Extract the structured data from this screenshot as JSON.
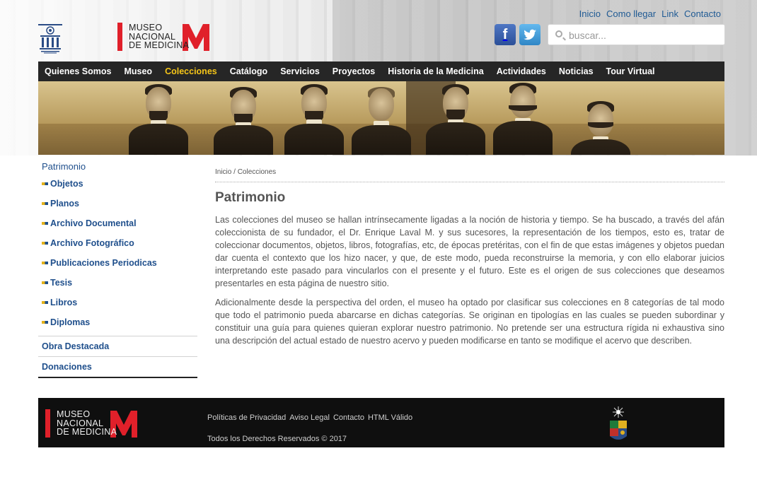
{
  "top_links": [
    "Inicio",
    "Como llegar",
    "Link",
    "Contacto"
  ],
  "logo": {
    "lines": [
      "MUSEO",
      "NACIONAL",
      "DE MEDICINA"
    ],
    "mark": "M"
  },
  "social": [
    "facebook-icon",
    "twitter-icon"
  ],
  "search": {
    "placeholder": "buscar..."
  },
  "nav": [
    {
      "label": "Quienes Somos",
      "active": false
    },
    {
      "label": "Museo",
      "active": false
    },
    {
      "label": "Colecciones",
      "active": true
    },
    {
      "label": "Catálogo",
      "active": false
    },
    {
      "label": "Servicios",
      "active": false
    },
    {
      "label": "Proyectos",
      "active": false
    },
    {
      "label": "Historia de la Medicina",
      "active": false
    },
    {
      "label": "Actividades",
      "active": false
    },
    {
      "label": "Noticias",
      "active": false
    },
    {
      "label": "Tour Virtual",
      "active": false
    }
  ],
  "sidebar": {
    "title": "Patrimonio",
    "items": [
      "Objetos",
      "Planos",
      "Archivo Documental",
      "Archivo Fotográfico",
      "Publicaciones Periodicas",
      "Tesis",
      "Libros",
      "Diplomas"
    ],
    "groups": [
      "Obra Destacada",
      "Donaciones"
    ]
  },
  "breadcrumb": {
    "home": "Inicio",
    "separator": "/",
    "current": "Colecciones"
  },
  "main": {
    "title": "Patrimonio",
    "paragraphs": [
      "Las colecciones del museo se hallan intrínsecamente ligadas a la noción de historia y tiempo. Se ha buscado, a través del afán coleccionista de su fundador, el Dr. Enrique Laval M. y sus sucesores, la representación de los tiempos, esto es, tratar de coleccionar documentos, objetos, libros, fotografías, etc, de épocas pretéritas, con el fin de que estas  imágenes y objetos puedan dar cuenta  el contexto que los hizo nacer, y que, de este modo, pueda reconstruirse la memoria, y con ello elaborar juicios interpretando este pasado para vincularlos con el presente y el futuro. Este es el origen de sus colecciones que deseamos presentarles en esta página de nuestro sitio.",
      "Adicionalmente desde la perspectiva del orden, el  museo ha optado por clasificar  sus colecciones en 8 categorías de tal modo que todo el patrimonio pueda abarcarse en dichas categorías.  Se originan en  tipologías en las cuales se pueden subordinar y constituir una guía para quienes quieran explorar nuestro patrimonio. No pretende ser una estructura rígida ni exhaustiva sino una descripción del actual estado de nuestro acervo y pueden modificarse en tanto se modifique el acervo que describen."
    ]
  },
  "footer": {
    "links": [
      "Políticas de Privacidad",
      "Aviso Legal",
      "Contacto",
      "HTML Válido"
    ],
    "copyright": "Todos los Derechos Reservados © 2017"
  },
  "colors": {
    "nav_bg": "#262626",
    "nav_active": "#f5c518",
    "link_blue": "#1f4f8c",
    "brand_red": "#e0202a",
    "footer_bg": "#0f0f0f"
  }
}
